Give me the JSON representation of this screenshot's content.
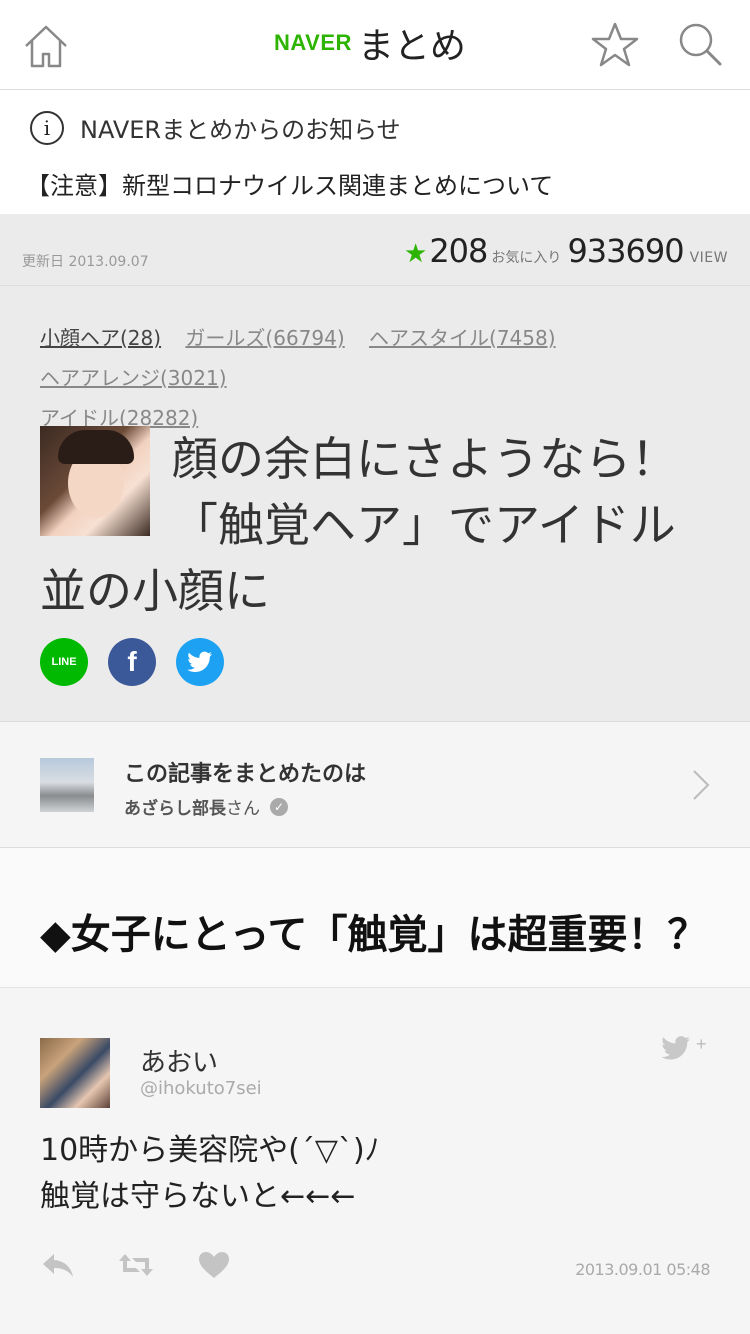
{
  "header": {
    "logo_naver": "NAVER",
    "logo_matome": "まとめ",
    "icons": [
      "home-icon",
      "star-icon",
      "search-icon"
    ]
  },
  "notice": {
    "title": "NAVERまとめからのお知らせ",
    "link": "【注意】新型コロナウイルス関連まとめについて"
  },
  "meta": {
    "updated": "更新日 2013.09.07",
    "fav_count": "208",
    "fav_label": "お気に入り",
    "view_count": "933690",
    "view_label": "VIEW"
  },
  "tags": [
    {
      "label": "小顔ヘア(28)"
    },
    {
      "label": "ガールズ(66794)"
    },
    {
      "label": "ヘアスタイル(7458)"
    },
    {
      "label": "ヘアアレンジ(3021)"
    },
    {
      "label": "アイドル(28282)"
    }
  ],
  "article": {
    "title": "顔の余白にさようなら！「触覚ヘア」でアイドル並の小顔に"
  },
  "share": {
    "line_label": "LINE",
    "facebook_label": "f"
  },
  "author": {
    "label": "この記事をまとめたのは",
    "name": "あざらし部長",
    "suffix": "さん"
  },
  "section": {
    "title": "◆女子にとって「触覚」は超重要！？"
  },
  "tweet": {
    "name": "あおい",
    "handle": "@ihokuto7sei",
    "text": "10時から美容院や(´▽`)ﾉ\n触覚は守らないと←←←",
    "time": "2013.09.01 05:48"
  },
  "colors": {
    "accent": "#2db400",
    "line": "#00b900",
    "facebook": "#3b5998",
    "twitter": "#1da1f2"
  }
}
